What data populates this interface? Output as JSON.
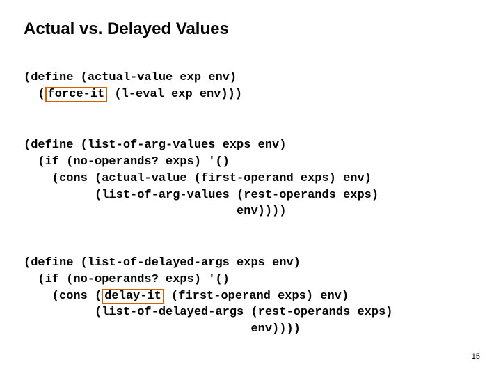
{
  "title": "Actual vs. Delayed Values",
  "code": {
    "b1l1a": "(define (actual-value exp env)",
    "b1l2a": "  (",
    "b1l2box": "force-it",
    "b1l2b": " (l-eval exp env)))",
    "b2l1": "(define (list-of-arg-values exps env)",
    "b2l2": "  (if (no-operands? exps) '()",
    "b2l3": "    (cons (actual-value (first-operand exps) env)",
    "b2l4": "          (list-of-arg-values (rest-operands exps)",
    "b2l5": "                              env))))",
    "b3l1": "(define (list-of-delayed-args exps env)",
    "b3l2": "  (if (no-operands? exps) '()",
    "b3l3a": "    (cons (",
    "b3l3box": "delay-it",
    "b3l3b": " (first-operand exps) env)",
    "b3l4": "          (list-of-delayed-args (rest-operands exps)",
    "b3l5": "                                env))))"
  },
  "page": "15"
}
